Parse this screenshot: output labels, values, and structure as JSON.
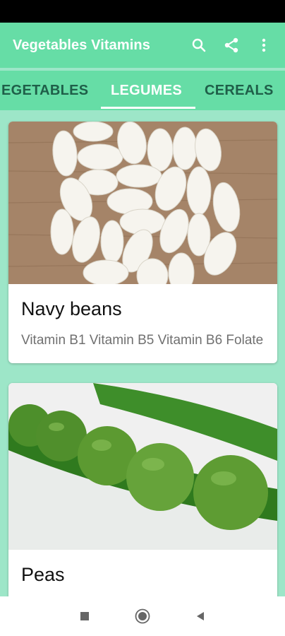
{
  "app_bar": {
    "title": "Vegetables Vitamins",
    "actions": [
      {
        "icon": "search-icon"
      },
      {
        "icon": "share-icon"
      },
      {
        "icon": "more-vert-icon"
      }
    ]
  },
  "tabs": [
    {
      "label": "EGETABLES",
      "active": false
    },
    {
      "label": "LEGUMES",
      "active": true
    },
    {
      "label": "CEREALS",
      "active": false
    }
  ],
  "cards": [
    {
      "title": "Navy beans",
      "description": "Vitamin B1 Vitamin B5 Vitamin B6 Folate"
    },
    {
      "title": "Peas",
      "description": ""
    }
  ],
  "colors": {
    "primary": "#66DDA6",
    "background": "#9DE6C8",
    "tab_active": "#FFFFFF",
    "tab_inactive": "#1F5F49"
  },
  "nav_bar": {
    "buttons": [
      {
        "icon": "recents-square-icon"
      },
      {
        "icon": "home-circle-icon"
      },
      {
        "icon": "back-triangle-icon"
      }
    ]
  }
}
